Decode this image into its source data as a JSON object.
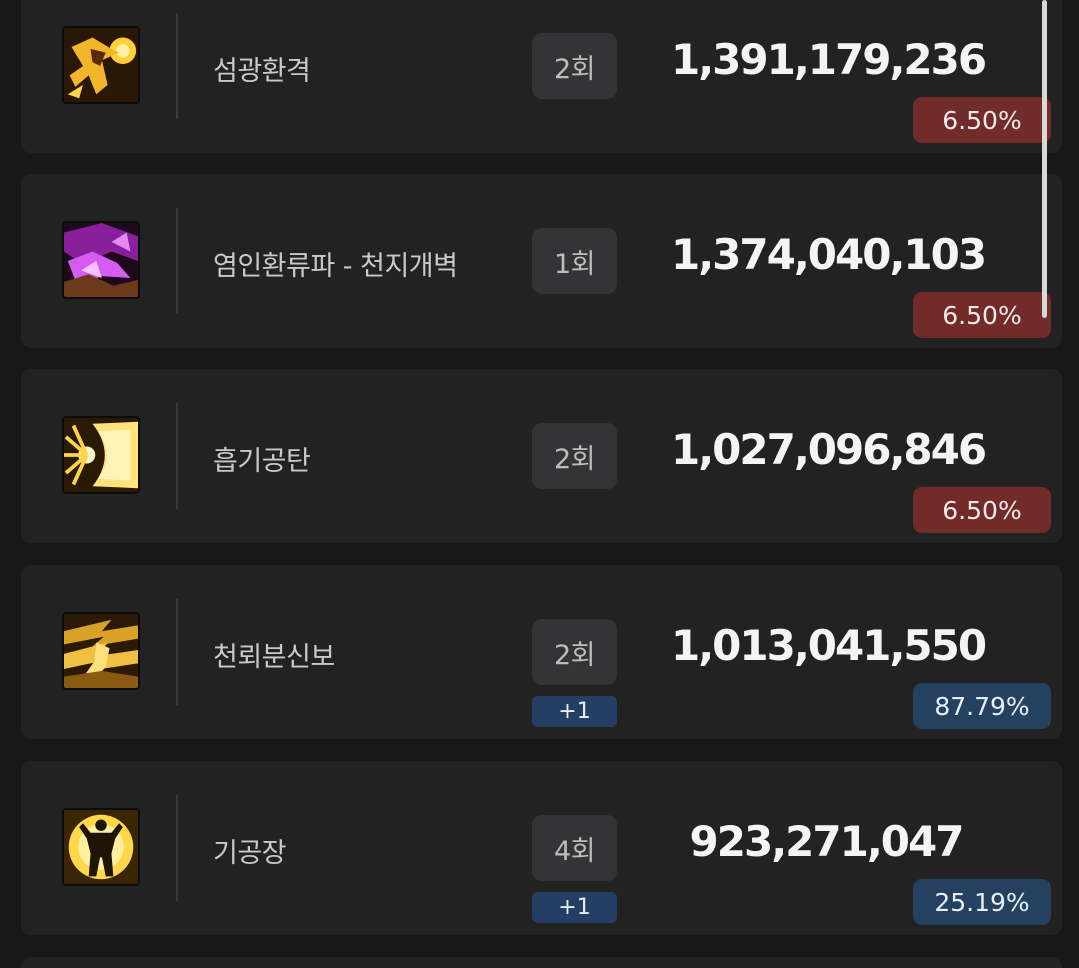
{
  "rows": [
    {
      "name": "섬광환격",
      "count": "2회",
      "plus": "",
      "damage": "1,391,179,236",
      "percent": "6.50%",
      "percent_color": "red",
      "icon": "flash-strike-icon"
    },
    {
      "name": "염인환류파 - 천지개벽",
      "count": "1회",
      "plus": "",
      "damage": "1,374,040,103",
      "percent": "6.50%",
      "percent_color": "red",
      "icon": "flame-wave-icon"
    },
    {
      "name": "흡기공탄",
      "count": "2회",
      "plus": "",
      "damage": "1,027,096,846",
      "percent": "6.50%",
      "percent_color": "red",
      "icon": "energy-blast-icon"
    },
    {
      "name": "천뢰분신보",
      "count": "2회",
      "plus": "+1",
      "damage": "1,013,041,550",
      "percent": "87.79%",
      "percent_color": "blue",
      "icon": "lightning-clone-icon"
    },
    {
      "name": "기공장",
      "count": "4회",
      "plus": "+1",
      "damage": "923,271,047",
      "percent": "25.19%",
      "percent_color": "blue",
      "icon": "qi-palm-icon"
    }
  ],
  "colors": {
    "background": "#181818",
    "row": "#222223",
    "badge_red": "#712b29",
    "badge_blue": "#24415f"
  }
}
